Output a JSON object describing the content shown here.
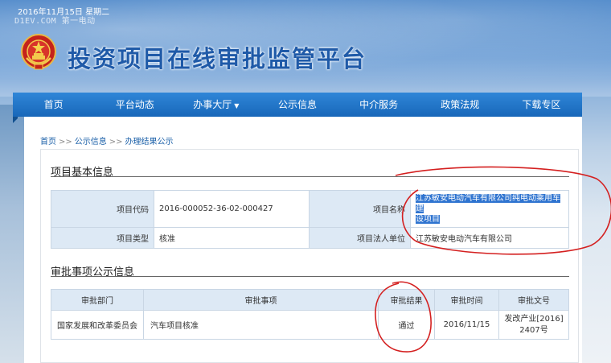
{
  "header": {
    "date": "2016年11月15日 星期二",
    "watermark": "D1EV.COM 第一电动",
    "title": "投资项目在线审批监管平台"
  },
  "nav": {
    "items": [
      {
        "label": "首页"
      },
      {
        "label": "平台动态"
      },
      {
        "label": "办事大厅",
        "dropdown": true
      },
      {
        "label": "公示信息"
      },
      {
        "label": "中介服务"
      },
      {
        "label": "政策法规"
      },
      {
        "label": "下载专区"
      }
    ],
    "caret": "▼"
  },
  "breadcrumb": {
    "items": [
      "首页",
      "公示信息",
      "办理结果公示"
    ],
    "sep": ">>"
  },
  "project": {
    "section_title": "项目基本信息",
    "code_label": "项目代码",
    "code_value": "2016-000052-36-02-000427",
    "name_label": "项目名称",
    "name_value_line1": "江苏敏安电动汽车有限公司纯电动乘用车建",
    "name_value_line2": "设项目",
    "type_label": "项目类型",
    "type_value": "核准",
    "legal_label": "项目法人单位",
    "legal_value": "江苏敏安电动汽车有限公司"
  },
  "approval": {
    "section_title": "审批事项公示信息",
    "headers": [
      "审批部门",
      "审批事项",
      "审批结果",
      "审批时间",
      "审批文号"
    ],
    "row": {
      "dept": "国家发展和改革委员会",
      "item": "汽车项目核准",
      "result": "通过",
      "time": "2016/11/15",
      "doc_line1": "发改产业[2016]",
      "doc_line2": "2407号"
    }
  },
  "colors": {
    "nav": "#1f73c6",
    "title": "#1f5aa8",
    "annotation": "#d42020",
    "highlight": "#2f74d0"
  }
}
